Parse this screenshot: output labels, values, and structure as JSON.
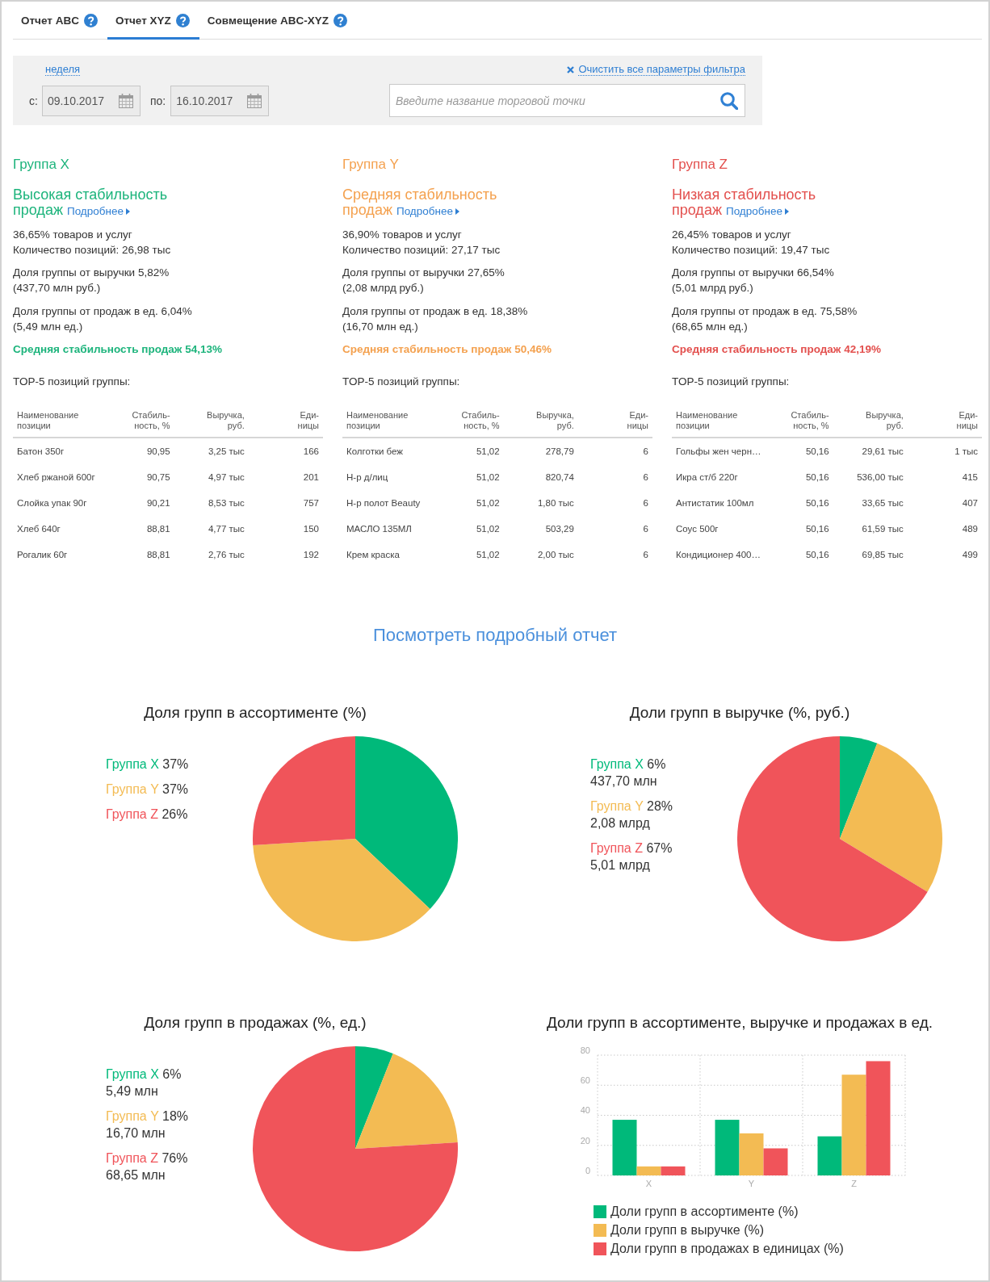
{
  "tabs": [
    {
      "label": "Отчет ABC",
      "selected": false
    },
    {
      "label": "Отчет XYZ",
      "selected": true
    },
    {
      "label": "Совмещение ABC-XYZ",
      "selected": false
    }
  ],
  "filter": {
    "period_link": "неделя",
    "clear_link": "Очистить все параметры фильтра",
    "from_label": "с:",
    "from_value": "09.10.2017",
    "to_label": "по:",
    "to_value": "16.10.2017",
    "search": {
      "placeholder": "Введите название торговой точки"
    }
  },
  "groups": [
    {
      "title": "Группа X",
      "color": "#1db47c",
      "heading": "Высокая стабильность продаж",
      "details_link": "Подробнее",
      "share_items": "36,65% товаров и услуг",
      "positions": "Количество позиций: 26,98 тыс",
      "revenue_share": "Доля группы от выручки 5,82%",
      "revenue_amount": "(437,70 млн руб.)",
      "sales_share": "Доля группы от продаж в ед. 6,04%",
      "sales_amount": "(5,49 млн ед.)",
      "avg_stability": "Средняя стабильность продаж 54,13%",
      "top_title": "TOP-5 позиций группы:",
      "table": {
        "columns": [
          "Наименование\nпозиции",
          "Стабиль-\nность, %",
          "Выручка,\nруб.",
          "Еди-\nницы"
        ],
        "rows": [
          [
            "Батон 350г",
            "90,95",
            "3,25 тыс",
            "166"
          ],
          [
            "Хлеб ржаной 600г",
            "90,75",
            "4,97 тыс",
            "201"
          ],
          [
            "Слойка упак 90г",
            "90,21",
            "8,53 тыс",
            "757"
          ],
          [
            "Хлеб 640г",
            "88,81",
            "4,77 тыс",
            "150"
          ],
          [
            "Рогалик 60г",
            "88,81",
            "2,76 тыс",
            "192"
          ]
        ]
      }
    },
    {
      "title": "Группа Y",
      "color": "#f4a14f",
      "heading": "Средняя стабильность продаж",
      "details_link": "Подробнее",
      "share_items": "36,90% товаров и услуг",
      "positions": "Количество позиций: 27,17 тыс",
      "revenue_share": "Доля группы от выручки 27,65%",
      "revenue_amount": "(2,08 млрд руб.)",
      "sales_share": "Доля группы от продаж в ед. 18,38%",
      "sales_amount": "(16,70 млн ед.)",
      "avg_stability": "Средняя стабильность продаж 50,46%",
      "top_title": "TOP-5 позиций группы:",
      "table": {
        "columns": [
          "Наименование\nпозиции",
          "Стабиль-\nность, %",
          "Выручка,\nруб.",
          "Еди-\nницы"
        ],
        "rows": [
          [
            "Колготки беж",
            "51,02",
            "278,79",
            "6"
          ],
          [
            "Н-р д/лиц",
            "51,02",
            "820,74",
            "6"
          ],
          [
            "Н-р полот Beauty",
            "51,02",
            "1,80 тыс",
            "6"
          ],
          [
            "МАСЛО 135МЛ",
            "51,02",
            "503,29",
            "6"
          ],
          [
            "Крем краска",
            "51,02",
            "2,00 тыс",
            "6"
          ]
        ]
      }
    },
    {
      "title": "Группа Z",
      "color": "#e3504e",
      "heading": "Низкая стабильность продаж",
      "details_link": "Подробнее",
      "share_items": "26,45% товаров и услуг",
      "positions": "Количество позиций: 19,47 тыс",
      "revenue_share": "Доля группы от выручки 66,54%",
      "revenue_amount": "(5,01 млрд руб.)",
      "sales_share": "Доля группы от продаж в ед. 75,58%",
      "sales_amount": "(68,65 млн ед.)",
      "avg_stability": "Средняя стабильность продаж 42,19%",
      "top_title": "TOP-5 позиций группы:",
      "table": {
        "columns": [
          "Наименование\nпозиции",
          "Стабиль-\nность, %",
          "Выручка,\nруб.",
          "Еди-\nницы"
        ],
        "rows": [
          [
            "Гольфы жен черн…",
            "50,16",
            "29,61 тыс",
            "1 тыс"
          ],
          [
            "Икра ст/б 220г",
            "50,16",
            "536,00 тыс",
            "415"
          ],
          [
            "Антистатик 100мл",
            "50,16",
            "33,65 тыс",
            "407"
          ],
          [
            "Соус 500г",
            "50,16",
            "61,59 тыс",
            "489"
          ],
          [
            "Кондиционер 400…",
            "50,16",
            "69,85 тыс",
            "499"
          ]
        ]
      }
    }
  ],
  "report_link": "Посмотреть подробный отчет",
  "charts": [
    {
      "chart_data": {
        "type": "pie",
        "title": "Доля групп в ассортименте (%)",
        "categories": [
          "Группа X",
          "Группа Y",
          "Группа Z"
        ],
        "values": [
          37,
          37,
          26
        ]
      },
      "legend": [
        {
          "color": "#00b97a",
          "value": "37%"
        },
        {
          "color": "#f3bb53",
          "value": "37%"
        },
        {
          "color": "#f0545a",
          "value": "26%"
        }
      ]
    },
    {
      "chart_data": {
        "type": "pie",
        "title": "Доли групп в выручке (%, руб.)",
        "categories": [
          "Группа X",
          "Группа Y",
          "Группа Z"
        ],
        "values": [
          6,
          28,
          67
        ]
      },
      "legend": [
        {
          "color": "#00b97a",
          "value": "6%",
          "amount": "437,70 млн"
        },
        {
          "color": "#f3bb53",
          "value": "28%",
          "amount": "2,08 млрд"
        },
        {
          "color": "#f0545a",
          "value": "67%",
          "amount": "5,01 млрд"
        }
      ]
    },
    {
      "chart_data": {
        "type": "pie",
        "title": "Доля групп в продажах (%, ед.)",
        "categories": [
          "Группа X",
          "Группа Y",
          "Группа Z"
        ],
        "values": [
          6,
          18,
          76
        ]
      },
      "legend": [
        {
          "color": "#00b97a",
          "value": "6%",
          "amount": "5,49 млн"
        },
        {
          "color": "#f3bb53",
          "value": "18%",
          "amount": "16,70 млн"
        },
        {
          "color": "#f0545a",
          "value": "76%",
          "amount": "68,65 млн"
        }
      ]
    },
    {
      "chart_data": {
        "type": "bar",
        "title": "Доли групп в ассортименте, выручке и продажах в ед.",
        "categories": [
          "X",
          "Y",
          "Z"
        ],
        "series": [
          {
            "name": "Доли групп в ассортименте (%)",
            "color": "#00b97a",
            "values": [
              37,
              37,
              26
            ]
          },
          {
            "name": "Доли групп в выручке (%)",
            "color": "#f3bb53",
            "values": [
              6,
              28,
              67
            ]
          },
          {
            "name": "Доли групп в продажах в единицах (%)",
            "color": "#f0545a",
            "values": [
              6,
              18,
              76
            ]
          }
        ],
        "ylim": [
          0,
          80
        ],
        "yticks": [
          0,
          20,
          40,
          60,
          80
        ],
        "grid": true
      }
    }
  ]
}
